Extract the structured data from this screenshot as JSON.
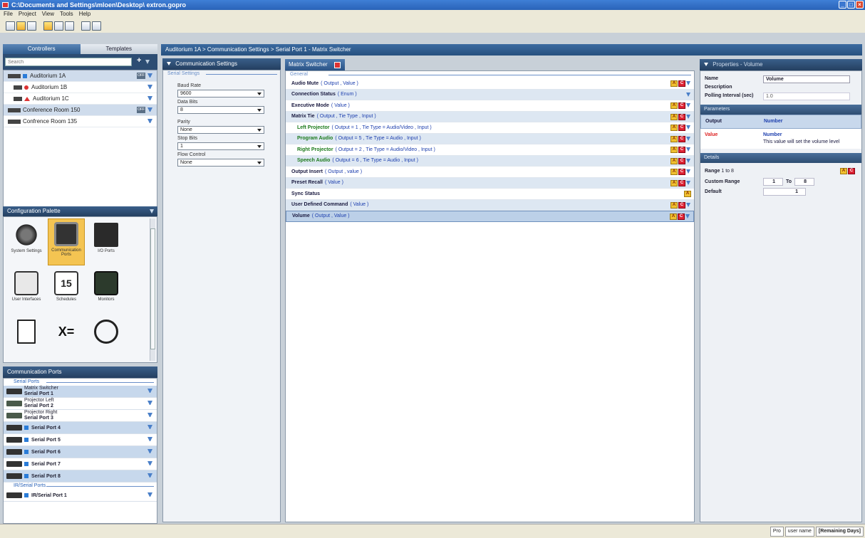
{
  "window": {
    "title": "C:\\Documents and Settings\\mloen\\Desktop\\ extron.gopro"
  },
  "menu": [
    "File",
    "Project",
    "View",
    "Tools",
    "Help"
  ],
  "left": {
    "tabs": {
      "controllers": "Controllers",
      "templates": "Templates"
    },
    "search_placeholder": "Search",
    "controllers": [
      {
        "label": "Auditorium 1A",
        "badge": "OFF",
        "icon": "square-icon"
      },
      {
        "label": "Auditorium 1B",
        "badge": "",
        "icon": "dot-icon"
      },
      {
        "label": "Auditorium 1C",
        "badge": "",
        "icon": "triangle-icon"
      },
      {
        "label": "Conference Room 150",
        "badge": "OFF",
        "icon": ""
      },
      {
        "label": "Confrence Room 135",
        "badge": "",
        "icon": ""
      }
    ],
    "palette": {
      "header": "Configuration Palette",
      "items": [
        {
          "label": "System Settings",
          "icon": "gears-icon"
        },
        {
          "label": "Communication Ports",
          "icon": "comm-ports-icon"
        },
        {
          "label": "I/O Ports",
          "icon": "io-ports-icon"
        },
        {
          "label": "User Interfaces",
          "icon": "touch-panel-icon"
        },
        {
          "label": "Schedules",
          "icon": "calendar-icon"
        },
        {
          "label": "Monitors",
          "icon": "monitor-icon"
        },
        {
          "label": "",
          "icon": "document-icon"
        },
        {
          "label": "",
          "icon": "variable-icon"
        },
        {
          "label": "",
          "icon": "timer-icon"
        }
      ]
    },
    "ports": {
      "header": "Communication Ports",
      "serial_group": "Serial Ports",
      "serial": [
        {
          "name": "Matrix Switcher",
          "port": "Serial Port 1"
        },
        {
          "name": "Projector Left",
          "port": "Serial Port 2"
        },
        {
          "name": "Projector Right",
          "port": "Serial Port 3"
        },
        {
          "name": "",
          "port": "Serial Port 4"
        },
        {
          "name": "",
          "port": "Serial Port 5"
        },
        {
          "name": "",
          "port": "Serial Port 6"
        },
        {
          "name": "",
          "port": "Serial Port 7"
        },
        {
          "name": "",
          "port": "Serial Port 8"
        }
      ],
      "ir_group": "IR/Serial Ports",
      "ir": [
        {
          "name": "",
          "port": "IR/Serial Port 1"
        }
      ]
    }
  },
  "breadcrumb": "Auditorium 1A > Communication Settings > Serial Port 1 - Matrix Switcher",
  "comm": {
    "header": "Communication Settings",
    "group": "Serial Settings",
    "fields": [
      {
        "label": "Baud Rate",
        "value": "9600"
      },
      {
        "label": "Data Bits",
        "value": "8"
      },
      {
        "label": "Parity",
        "value": "None"
      },
      {
        "label": "Stop Bits",
        "value": "1"
      },
      {
        "label": "Flow Control",
        "value": "None"
      }
    ]
  },
  "commands": {
    "tab": "Matrix Switcher",
    "group": "General",
    "rows": [
      {
        "name": "Audio Mute",
        "params": "( Output , Value )",
        "indent": false,
        "green": false,
        "a": true,
        "c": true,
        "f": true
      },
      {
        "name": "Connection Status",
        "params": "( Enum )",
        "indent": false,
        "green": false,
        "a": false,
        "c": false,
        "f": true
      },
      {
        "name": "Executive Mode",
        "params": "( Value )",
        "indent": false,
        "green": false,
        "a": true,
        "c": true,
        "f": true
      },
      {
        "name": "Matrix Tie",
        "params": "( Output , Tie Type , Input )",
        "indent": false,
        "green": false,
        "a": true,
        "c": true,
        "f": true
      },
      {
        "name": "Left Projector",
        "params": "( Output = 1 , Tie Type = Audio/Video , Input )",
        "indent": true,
        "green": true,
        "a": true,
        "c": true,
        "f": true
      },
      {
        "name": "Program Audio",
        "params": "( Output = 5 , Tie Type = Audio , Input )",
        "indent": true,
        "green": true,
        "a": true,
        "c": true,
        "f": true
      },
      {
        "name": "Right Projector",
        "params": "( Output = 2 , Tie Type = Audio/Video , Input )",
        "indent": true,
        "green": true,
        "a": true,
        "c": true,
        "f": true
      },
      {
        "name": "Speech Audio",
        "params": "( Output = 6 , Tie Type = Audio , Input )",
        "indent": true,
        "green": true,
        "a": true,
        "c": true,
        "f": true
      },
      {
        "name": "Output Insert",
        "params": "( Output , value )",
        "indent": false,
        "green": false,
        "a": true,
        "c": true,
        "f": true
      },
      {
        "name": "Preset Recall",
        "params": "( Value )",
        "indent": false,
        "green": false,
        "a": true,
        "c": true,
        "f": true
      },
      {
        "name": "Sync Status",
        "params": "",
        "indent": false,
        "green": false,
        "a": true,
        "c": false,
        "f": false
      },
      {
        "name": "User Defined Command",
        "params": "( Value )",
        "indent": false,
        "green": false,
        "a": true,
        "c": true,
        "f": true
      },
      {
        "name": "Volume",
        "params": "( Output , Value )",
        "indent": false,
        "green": false,
        "a": true,
        "c": true,
        "f": true
      }
    ]
  },
  "properties": {
    "header": "Properties - Volume",
    "name_label": "Name",
    "name_value": "Volume",
    "desc_label": "Description",
    "poll_label": "Polling Interval (sec)",
    "poll_value": "1.0",
    "params_header": "Parameters",
    "params": [
      {
        "name": "Output",
        "type": "Number",
        "desc": ""
      },
      {
        "name": "Value",
        "type": "Number",
        "desc": "This value will set the volume level"
      }
    ],
    "details_header": "Details",
    "range_label": "Range",
    "range_value": "1 to 8",
    "custom_label": "Custom Range",
    "custom_from": "1",
    "to_label": "To",
    "custom_to": "8",
    "default_label": "Default",
    "default_value": "1"
  },
  "status": {
    "edition": "Pro",
    "user": "user name",
    "days": "[Remaining Days]"
  },
  "colors": {
    "accent": "#2a63b8",
    "header": "#243f60",
    "selected": "#f4c452",
    "badge_a": "#f0c030",
    "badge_c": "#d22233"
  }
}
